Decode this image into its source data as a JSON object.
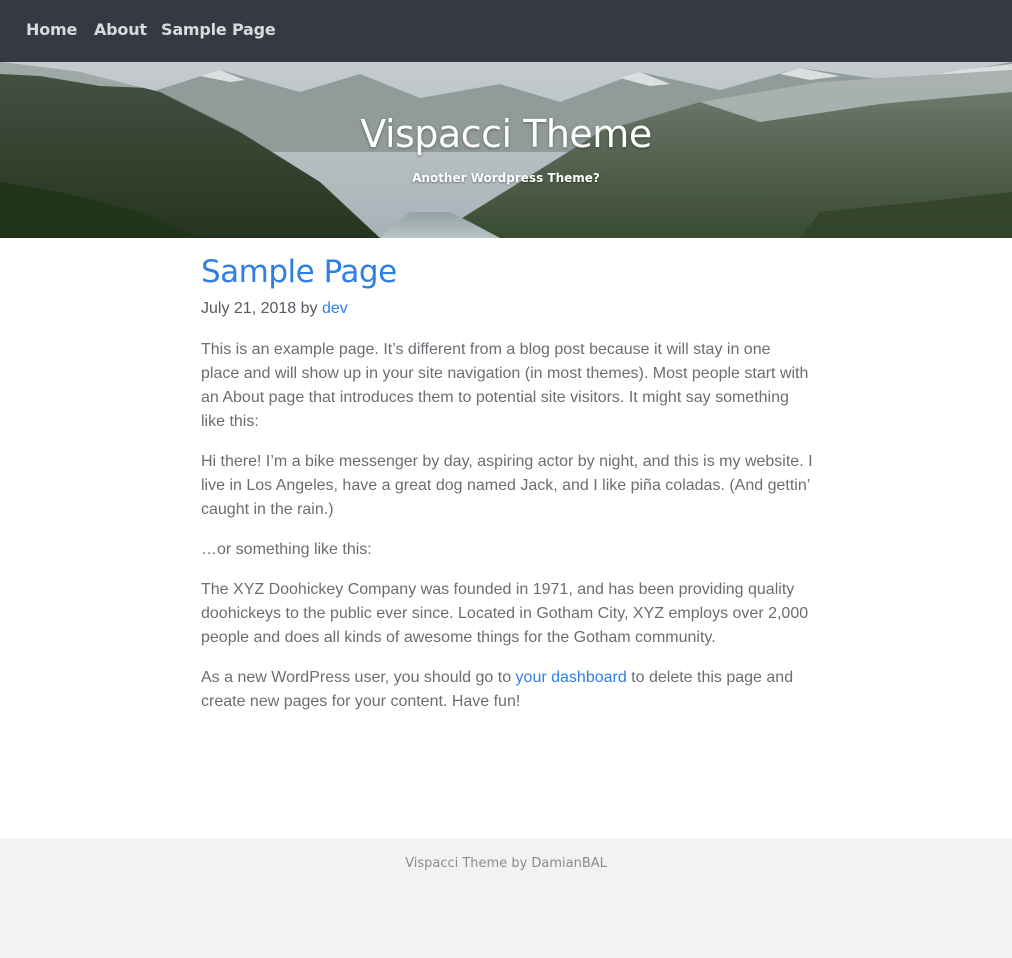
{
  "nav": {
    "items": [
      {
        "label": "Home"
      },
      {
        "label": "About"
      },
      {
        "label": "Sample Page"
      }
    ]
  },
  "header": {
    "site_title": "Vispacci Theme",
    "tagline": "Another Wordpress Theme?"
  },
  "post": {
    "title": "Sample Page",
    "date": "July 21, 2018",
    "by": "by",
    "author": "dev",
    "paragraphs": [
      "This is an example page. It’s different from a blog post because it will stay in one place and will show up in your site navigation (in most themes). Most people start with an About page that introduces them to potential site visitors. It might say something like this:",
      "Hi there! I’m a bike messenger by day, aspiring actor by night, and this is my website. I live in Los Angeles, have a great dog named Jack, and I like piña coladas. (And gettin’ caught in the rain.)",
      "…or something like this:",
      "The XYZ Doohickey Company was founded in 1971, and has been providing quality doohickeys to the public ever since. Located in Gotham City, XYZ employs over 2,000 people and does all kinds of awesome things for the Gotham community."
    ],
    "last_paragraph": {
      "before": "As a new WordPress user, you should go to ",
      "link": "your dashboard",
      "after": " to delete this page and create new pages for your content. Have fun!"
    }
  },
  "footer": {
    "text": "Vispacci Theme by DamianBAL"
  },
  "colors": {
    "nav_bg": "#353a42",
    "accent": "#2f7fe6",
    "footer_bg": "#f2f2f2"
  }
}
